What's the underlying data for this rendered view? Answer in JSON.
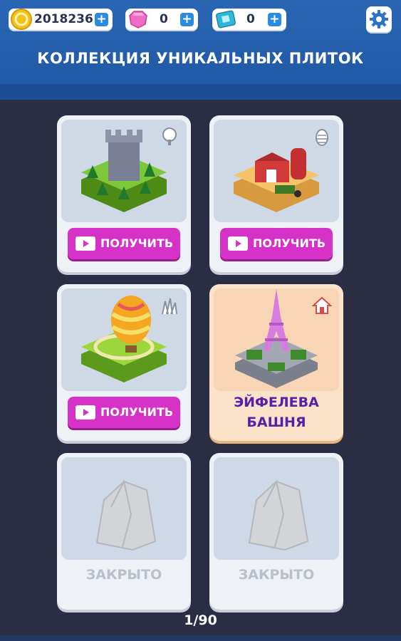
{
  "hud": {
    "coins": "2018236",
    "gems": "0",
    "tickets": "0",
    "plus": "+"
  },
  "header": {
    "title": "КОЛЛЕКЦИЯ УНИКАЛЬНЫХ ПЛИТОК"
  },
  "cards": [
    {
      "name": "castle-tower-tile",
      "button": "ПОЛУЧИТЬ",
      "biome_icon": "tree-icon"
    },
    {
      "name": "farm-barn-tile",
      "button": "ПОЛУЧИТЬ",
      "biome_icon": "pinecone-icon"
    },
    {
      "name": "hot-air-balloon-tile",
      "button": "ПОЛУЧИТЬ",
      "biome_icon": "grass-icon"
    },
    {
      "name": "eiffel-tower-tile",
      "label_line1": "ЭЙФЕЛЕВА",
      "label_line2": "БАШНЯ",
      "biome_icon": "house-icon"
    },
    {
      "name": "locked-tile-1",
      "label": "ЗАКРЫТО"
    },
    {
      "name": "locked-tile-2",
      "label": "ЗАКРЫТО"
    }
  ],
  "pager": {
    "text": "1/90"
  },
  "colors": {
    "accent": "#d732c8",
    "header": "#2a66b4",
    "background": "#2b2d45"
  }
}
